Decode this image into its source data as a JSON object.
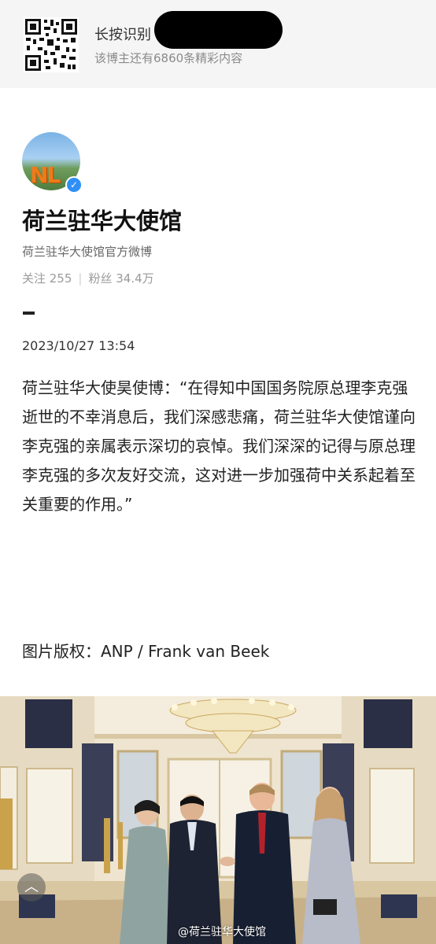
{
  "banner": {
    "title": "长按识别",
    "subtitle": "该博主还有6860条精彩内容"
  },
  "profile": {
    "avatar_text": "NL",
    "name": "荷兰驻华大使馆",
    "bio": "荷兰驻华大使馆官方微博",
    "following_label": "关注 255",
    "followers_label": "粉丝 34.4万"
  },
  "post": {
    "date": "2023/10/27 13:54",
    "text": "荷兰驻华大使昊使博：“在得知中国国务院原总理李克强逝世的不幸消息后，我们深感悲痛，荷兰驻华大使馆谨向李克强的亲属表示深切的哀悼。我们深深的记得与原总理李克强的多次友好交流，这对进一步加强荷中关系起着至关重要的作用。”",
    "credit": "图片版权：ANP / Frank van Beek",
    "image_watermark": "@荷兰驻华大使馆"
  },
  "icons": {
    "qr": "qr-code-icon",
    "verify": "verified-badge-icon",
    "back_to_top": "chevron-up-icon"
  },
  "colors": {
    "verify_blue": "#2f8ff7",
    "banner_bg": "#f5f5f5",
    "avatar_orange": "#f07a1a"
  }
}
